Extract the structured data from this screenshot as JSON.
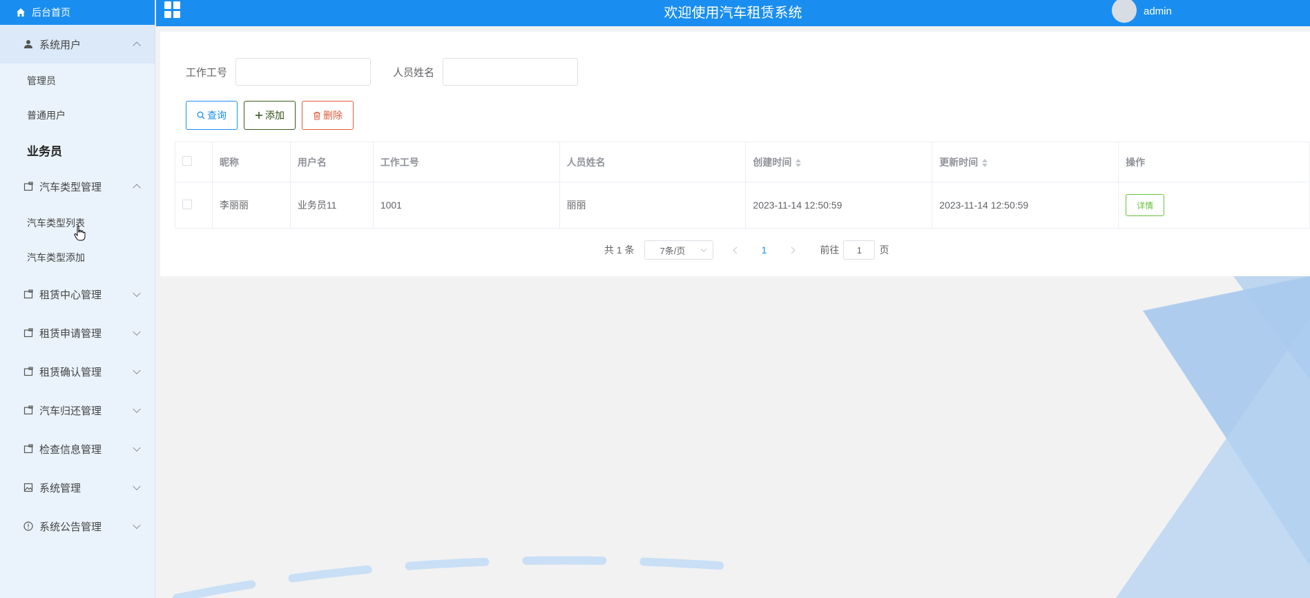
{
  "sidebar": {
    "home_label": "后台首页",
    "groups": [
      {
        "label": "系统用户",
        "icon": "user-icon",
        "expanded": true,
        "items": [
          "管理员",
          "普通用户",
          "业务员"
        ],
        "current": "业务员"
      },
      {
        "label": "汽车类型管理",
        "icon": "folder-icon",
        "expanded": true,
        "items": [
          "汽车类型列表",
          "汽车类型添加"
        ]
      },
      {
        "label": "租赁中心管理",
        "icon": "folder-icon",
        "expanded": false
      },
      {
        "label": "租赁申请管理",
        "icon": "folder-icon",
        "expanded": false
      },
      {
        "label": "租赁确认管理",
        "icon": "folder-icon",
        "expanded": false
      },
      {
        "label": "汽车归还管理",
        "icon": "folder-icon",
        "expanded": false
      },
      {
        "label": "检查信息管理",
        "icon": "folder-icon",
        "expanded": false
      },
      {
        "label": "系统管理",
        "icon": "image-icon",
        "expanded": false
      },
      {
        "label": "系统公告管理",
        "icon": "info-circle-icon",
        "expanded": false
      }
    ]
  },
  "header": {
    "title": "欢迎使用汽车租赁系统",
    "username": "admin"
  },
  "search": {
    "job_no_label": "工作工号",
    "job_no_value": "",
    "name_label": "人员姓名",
    "name_value": ""
  },
  "buttons": {
    "query": "查询",
    "add": "添加",
    "delete": "删除"
  },
  "table": {
    "columns": [
      "昵称",
      "用户名",
      "工作工号",
      "人员姓名",
      "创建时间",
      "更新时间",
      "操作"
    ],
    "rows": [
      {
        "nickname": "李丽丽",
        "username": "业务员11",
        "job_no": "1001",
        "name": "丽丽",
        "created": "2023-11-14 12:50:59",
        "updated": "2023-11-14 12:50:59",
        "action": "详情"
      }
    ]
  },
  "pagination": {
    "total": "共 1 条",
    "page_size": "7条/页",
    "current_page": "1",
    "goto_label": "前往",
    "goto_value": "1",
    "page_suffix": "页"
  },
  "colors": {
    "primary": "#1a8ef0",
    "success": "#67c23a",
    "danger": "#e05a3a",
    "sidebar_bg": "#eaf3fc"
  }
}
